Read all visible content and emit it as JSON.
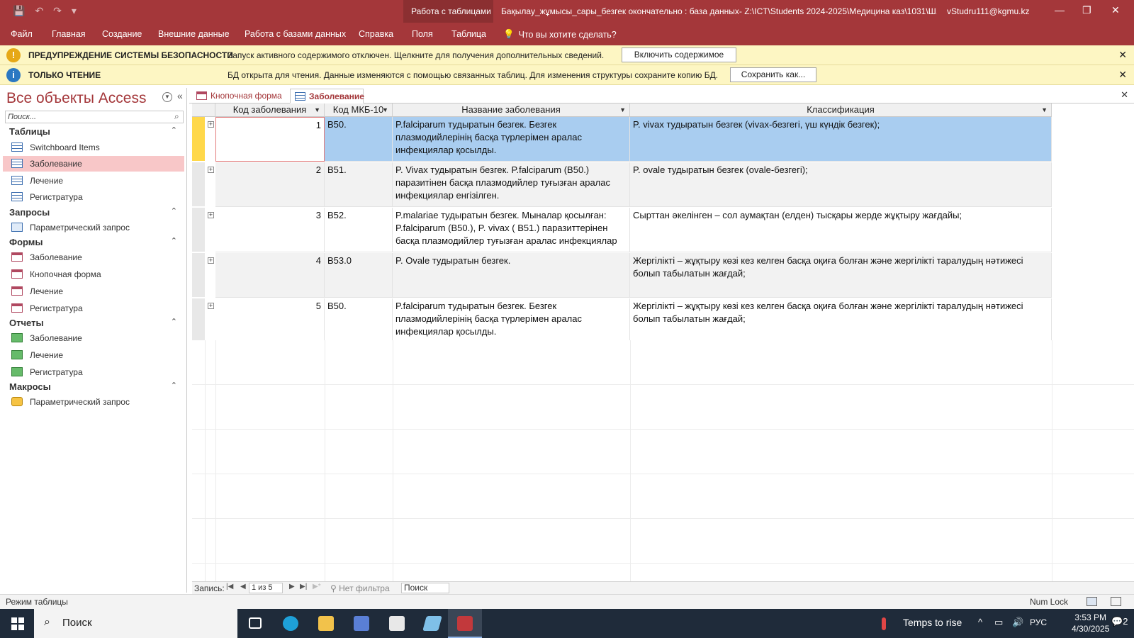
{
  "titlebar": {
    "context_tools": "Работа с таблицами",
    "title": "Бақылау_жұмысы_сары_безгек окончательно : база данных- Z:\\ICT\\Students 2024-2025\\Медицина каз\\1031\\Ш...",
    "user": "vStudru111@kgmu.kz"
  },
  "ribbon": {
    "tabs": [
      "Файл",
      "Главная",
      "Создание",
      "Внешние данные",
      "Работа с базами данных",
      "Справка",
      "Поля",
      "Таблица"
    ],
    "tellme": "Что вы хотите сделать?"
  },
  "security_bar": {
    "title": "ПРЕДУПРЕЖДЕНИЕ СИСТЕМЫ БЕЗОПАСНОСТИ",
    "text": "Запуск активного содержимого отключен. Щелкните для получения дополнительных сведений.",
    "button": "Включить содержимое"
  },
  "readonly_bar": {
    "title": "ТОЛЬКО ЧТЕНИЕ",
    "text": "БД открыта для чтения. Данные изменяются с помощью связанных таблиц. Для изменения структуры сохраните копию БД.",
    "button": "Сохранить как..."
  },
  "nav": {
    "title": "Все объекты Access",
    "search_placeholder": "Поиск...",
    "groups": [
      {
        "label": "Таблицы",
        "items": [
          "Switchboard Items",
          "Заболевание",
          "Лечение",
          "Регистратура"
        ]
      },
      {
        "label": "Запросы",
        "items": [
          "Параметрический запрос"
        ]
      },
      {
        "label": "Формы",
        "items": [
          "Заболевание",
          "Кнопочная форма",
          "Лечение",
          "Регистратура"
        ]
      },
      {
        "label": "Отчеты",
        "items": [
          "Заболевание",
          "Лечение",
          "Регистратура"
        ]
      },
      {
        "label": "Макросы",
        "items": [
          "Параметрический запрос"
        ]
      }
    ]
  },
  "doc_tabs": [
    "Кнопочная форма",
    "Заболевание"
  ],
  "table": {
    "columns": [
      "Код заболевания",
      "Код МКБ-10",
      "Название заболевания",
      "Классификация"
    ],
    "rows": [
      {
        "id": "1",
        "icd": "B50.",
        "name": " P.falciparum тудыратын безгек. Безгек плазмодийлерінің басқа түрлерімен аралас инфекциялар қосылды.",
        "cls": "P. vivax тудыратын безгек (vivax-безгегі, үш күндік безгек);"
      },
      {
        "id": "2",
        "icd": "B51.",
        "name": "P. Vivax тудыратын безгек. P.falciparum (B50.) паразитінен басқа плазмодийлер туғызған аралас инфекциялар енгізілген.",
        "cls": "P. ovale тудыратын безгек (ovale-безгегі);"
      },
      {
        "id": "3",
        "icd": "B52.",
        "name": "P.malariae тудыратын безгек. Мыналар қосылған: P.falciparum (B50.), P. vivax ( B51.) паразиттерінен басқа плазмодийлер туғызған аралас инфекциялар",
        "cls": "Сырттан әкелінген – сол аумақтан (елден) тысқары жерде жұқтыру жағдайы;"
      },
      {
        "id": "4",
        "icd": "B53.0",
        "name": "P. Ovale тудыратын безгек.",
        "cls": "Жергілікті – жұқтыру көзі кез келген басқа оқиға болған және жергілікті таралудың нәтижесі болып табылатын жағдай;"
      },
      {
        "id": "5",
        "icd": "B50.",
        "name": " P.falciparum тудыратын безгек. Безгек плазмодийлерінің басқа түрлерімен аралас инфекциялар қосылды.",
        "cls": "Жергілікті – жұқтыру көзі кез келген басқа оқиға болған және жергілікті таралудың нәтижесі болып табылатын жағдай;"
      }
    ]
  },
  "recnav": {
    "label": "Запись:",
    "current": "1 из 5",
    "filter": "Нет фильтра",
    "search": "Поиск"
  },
  "status": {
    "mode": "Режим таблицы",
    "numlock": "Num Lock"
  },
  "taskbar": {
    "search": "Поиск",
    "weather": "Temps to rise",
    "lang": "РУС",
    "time": "3:53 PM",
    "date": "4/30/2025",
    "notifications": "2"
  },
  "colors": {
    "accent": "#a4373a",
    "message_bar": "#fdf6c3",
    "selected_row": "#a9cdf0",
    "nav_selected": "#f8c7c8",
    "taskbar": "#1f2b3a"
  }
}
